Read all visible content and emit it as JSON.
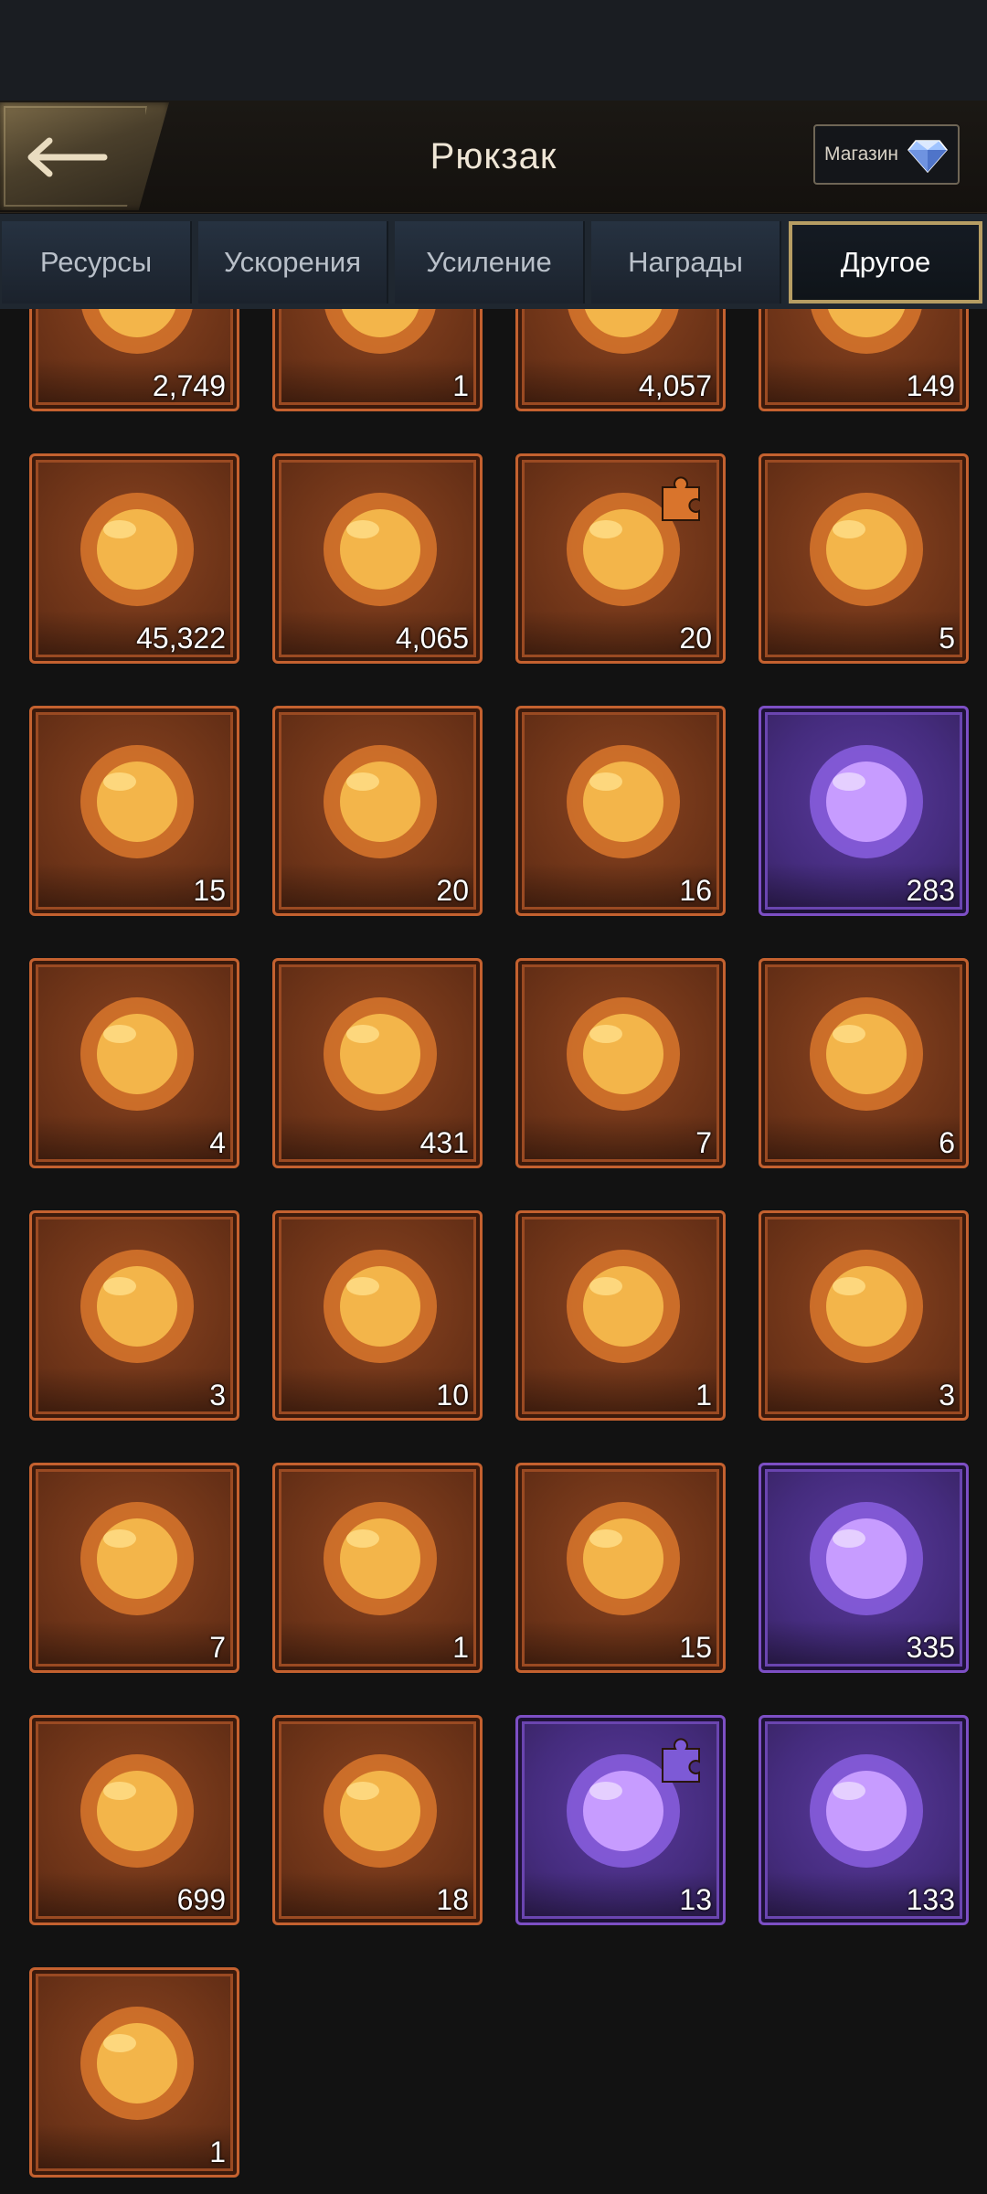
{
  "header": {
    "title": "Рюкзак",
    "shop_label": "Магазин"
  },
  "tabs": [
    {
      "label": "Ресурсы",
      "active": false
    },
    {
      "label": "Ускорения",
      "active": false
    },
    {
      "label": "Усиление",
      "active": false
    },
    {
      "label": "Награды",
      "active": false
    },
    {
      "label": "Другое",
      "active": true
    }
  ],
  "items": [
    {
      "icon": "amethyst-crystal-icon",
      "qty": "2,749",
      "rarity": "orange"
    },
    {
      "icon": "pink-gem-icon",
      "qty": "1",
      "rarity": "orange"
    },
    {
      "icon": "purple-flower-icon",
      "qty": "4,057",
      "rarity": "orange"
    },
    {
      "icon": "gold-flower-icon",
      "qty": "149",
      "rarity": "orange"
    },
    {
      "icon": "larva-on-leaf-icon",
      "qty": "45,322",
      "rarity": "orange"
    },
    {
      "icon": "beetle-in-amber-icon",
      "qty": "4,065",
      "rarity": "orange"
    },
    {
      "icon": "grub-in-amber-icon",
      "qty": "20",
      "rarity": "orange",
      "puzzle": true
    },
    {
      "icon": "blue-bacteria-icon",
      "qty": "5",
      "rarity": "orange"
    },
    {
      "icon": "pink-mushroom-icon",
      "qty": "15",
      "rarity": "orange"
    },
    {
      "icon": "beetle-star-badge-icon",
      "qty": "20",
      "rarity": "orange"
    },
    {
      "icon": "honey-drops-icon",
      "qty": "16",
      "rarity": "orange"
    },
    {
      "icon": "purple-orb-icon",
      "qty": "283",
      "rarity": "purple"
    },
    {
      "icon": "gene-chest-icon",
      "qty": "4",
      "rarity": "orange"
    },
    {
      "icon": "nectar-drop-icon",
      "qty": "431",
      "rarity": "orange"
    },
    {
      "icon": "ant-head-amber-icon",
      "qty": "7",
      "rarity": "orange"
    },
    {
      "icon": "spider-amber-icon",
      "qty": "6",
      "rarity": "orange"
    },
    {
      "icon": "moth-amber-icon",
      "qty": "3",
      "rarity": "orange"
    },
    {
      "icon": "pink-bacteria-icon",
      "qty": "10",
      "rarity": "orange"
    },
    {
      "icon": "cockroach-amber-icon",
      "qty": "1",
      "rarity": "orange"
    },
    {
      "icon": "mantis-amber-icon",
      "qty": "3",
      "rarity": "orange"
    },
    {
      "icon": "root-amber-icon",
      "qty": "7",
      "rarity": "orange"
    },
    {
      "icon": "crab-heart-amber-icon",
      "qty": "1",
      "rarity": "orange"
    },
    {
      "icon": "violet-honey-icon",
      "qty": "15",
      "rarity": "orange"
    },
    {
      "icon": "soil-clump-icon",
      "qty": "335",
      "rarity": "purple"
    },
    {
      "icon": "dew-drop-icon",
      "qty": "699",
      "rarity": "orange"
    },
    {
      "icon": "orange-crystal-icon",
      "qty": "18",
      "rarity": "orange"
    },
    {
      "icon": "succulent-icon",
      "qty": "13",
      "rarity": "purple",
      "puzzle": true
    },
    {
      "icon": "seeds-pile-icon",
      "qty": "133",
      "rarity": "purple"
    },
    {
      "icon": "yellow-leaf-icon",
      "qty": "1",
      "rarity": "orange"
    }
  ],
  "colors": {
    "orange_slot": "#c4612f",
    "purple_slot": "#7d4fc5",
    "active_tab_border": "#b69d63"
  }
}
